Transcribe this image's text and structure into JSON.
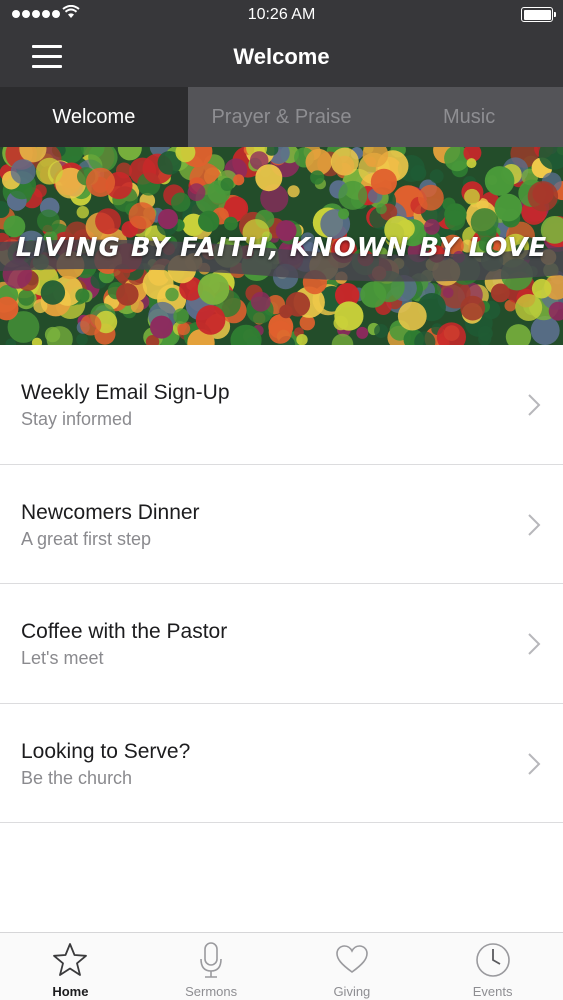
{
  "status_bar": {
    "time": "10:26 AM",
    "signal_icon": "signal-dots-icon",
    "wifi_icon": "wifi-icon",
    "battery_icon": "battery-icon",
    "battery_level": 1.0
  },
  "nav": {
    "title": "Welcome",
    "menu_icon": "hamburger-menu-icon"
  },
  "tabs": [
    {
      "label": "Welcome",
      "active": true
    },
    {
      "label": "Prayer & Praise",
      "active": false
    },
    {
      "label": "Music",
      "active": false
    }
  ],
  "banner": {
    "text": "LIVING BY FAITH, KNOWN BY LOVE"
  },
  "list": [
    {
      "title": "Weekly Email Sign-Up",
      "subtitle": "Stay informed"
    },
    {
      "title": "Newcomers Dinner",
      "subtitle": "A great first step"
    },
    {
      "title": "Coffee with the Pastor",
      "subtitle": "Let's meet"
    },
    {
      "title": "Looking to Serve?",
      "subtitle": "Be the church"
    }
  ],
  "tabbar": [
    {
      "label": "Home",
      "icon": "star-icon",
      "active": true
    },
    {
      "label": "Sermons",
      "icon": "microphone-icon",
      "active": false
    },
    {
      "label": "Giving",
      "icon": "heart-icon",
      "active": false
    },
    {
      "label": "Events",
      "icon": "clock-icon",
      "active": false
    }
  ],
  "colors": {
    "header_bg": "#37373a",
    "tab_inactive_bg": "#545458",
    "tab_active_bg": "#2c2c2e",
    "inactive_text": "#8e8e92"
  }
}
